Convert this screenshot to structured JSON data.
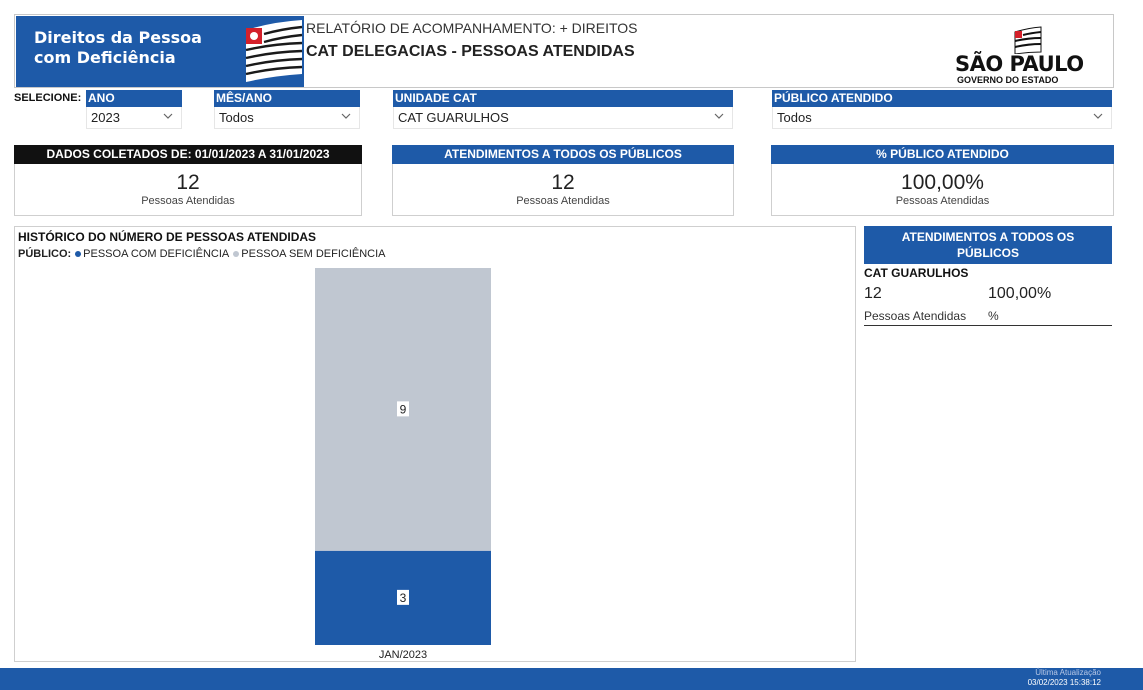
{
  "header": {
    "brand_line1": "Direitos da Pessoa",
    "brand_line2": "com Deficiência",
    "report_title": "RELATÓRIO DE ACOMPANHAMENTO: + DIREITOS",
    "report_subtitle": "CAT DELEGACIAS - PESSOAS ATENDIDAS",
    "logo_main": "SÃO PAULO",
    "logo_sub": "GOVERNO DO ESTADO"
  },
  "filters": {
    "select_label": "SELECIONE:",
    "ano": {
      "label": "ANO",
      "value": "2023"
    },
    "mes_ano": {
      "label": "MÊS/ANO",
      "value": "Todos"
    },
    "unidade": {
      "label": "UNIDADE CAT",
      "value": "CAT GUARULHOS"
    },
    "publico": {
      "label": "PÚBLICO ATENDIDO",
      "value": "Todos"
    }
  },
  "cards": [
    {
      "header": "DADOS COLETADOS DE: 01/01/2023 A 31/01/2023",
      "value": "12",
      "caption": "Pessoas Atendidas",
      "header_color": "#111111"
    },
    {
      "header": "ATENDIMENTOS A TODOS OS PÚBLICOS",
      "value": "12",
      "caption": "Pessoas Atendidas",
      "header_color": "#1e5aa8"
    },
    {
      "header": "% PÚBLICO ATENDIDO",
      "value": "100,00%",
      "caption": "Pessoas Atendidas",
      "header_color": "#1e5aa8"
    }
  ],
  "chart": {
    "title": "HISTÓRICO DO NÚMERO DE PESSOAS ATENDIDAS",
    "legend_title": "PÚBLICO:",
    "legend_items": [
      "PESSOA COM DEFICIÊNCIA",
      "PESSOA SEM DEFICIÊNCIA"
    ]
  },
  "chart_data": {
    "type": "bar",
    "stacked": true,
    "categories": [
      "JAN/2023"
    ],
    "series": [
      {
        "name": "PESSOA COM DEFICIÊNCIA",
        "values": [
          3
        ],
        "color": "#1e5aa8"
      },
      {
        "name": "PESSOA SEM DEFICIÊNCIA",
        "values": [
          9
        ],
        "color": "#c0c7d1"
      }
    ],
    "ylim": [
      0,
      12
    ],
    "grid": false,
    "legend_position": "top-left"
  },
  "side_panel": {
    "header_line1": "ATENDIMENTOS A TODOS OS",
    "header_line2": "PÚBLICOS",
    "unit": "CAT GUARULHOS",
    "count": "12",
    "percent": "100,00%",
    "count_caption": "Pessoas Atendidas",
    "percent_caption": "%"
  },
  "footer": {
    "label": "Última Atualização",
    "date": "03/02/2023 15:38:12"
  },
  "icons": {
    "flag": "sp-flag-icon",
    "dropdown": "chevron-down-icon"
  },
  "colors": {
    "brand_blue": "#1e5aa8",
    "light_gray": "#c0c7d1"
  }
}
